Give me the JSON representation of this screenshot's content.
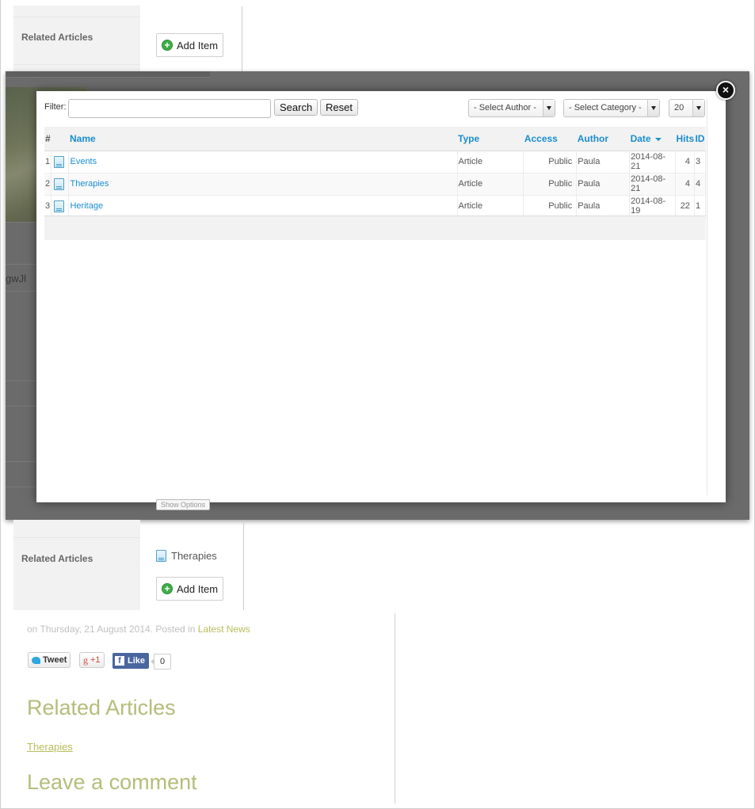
{
  "background_form": {
    "top_label": "Related Articles",
    "top_add_label": "Add Item",
    "bg_text_fragment": "gwJl",
    "show_options_label": "Show Options",
    "bottom_label": "Related Articles",
    "related_item": "Therapies",
    "bottom_add_label": "Add Item"
  },
  "modal": {
    "close_label": "×",
    "filter_label": "Filter:",
    "filter_value": "",
    "search_label": "Search",
    "reset_label": "Reset",
    "author_select": "- Select Author -",
    "category_select": "- Select Category -",
    "limit_select": "20",
    "columns": {
      "num": "#",
      "name": "Name",
      "type": "Type",
      "access": "Access",
      "author": "Author",
      "date": "Date",
      "hits": "Hits",
      "id": "ID"
    },
    "rows": [
      {
        "num": "1",
        "name": "Events",
        "type": "Article",
        "access": "Public",
        "author": "Paula",
        "date": "2014-08-21",
        "hits": "4",
        "id": "3"
      },
      {
        "num": "2",
        "name": "Therapies",
        "type": "Article",
        "access": "Public",
        "author": "Paula",
        "date": "2014-08-21",
        "hits": "4",
        "id": "4"
      },
      {
        "num": "3",
        "name": "Heritage",
        "type": "Article",
        "access": "Public",
        "author": "Paula",
        "date": "2014-08-19",
        "hits": "22",
        "id": "1"
      }
    ]
  },
  "article": {
    "meta_prefix": "on Thursday, 21 August 2014. Posted in ",
    "meta_category": "Latest News",
    "tweet_label": "Tweet",
    "gplus_label": "+1",
    "fb_like_label": "Like",
    "fb_count": "0",
    "related_heading": "Related Articles",
    "related_link": "Therapies",
    "comment_heading": "Leave a comment"
  }
}
